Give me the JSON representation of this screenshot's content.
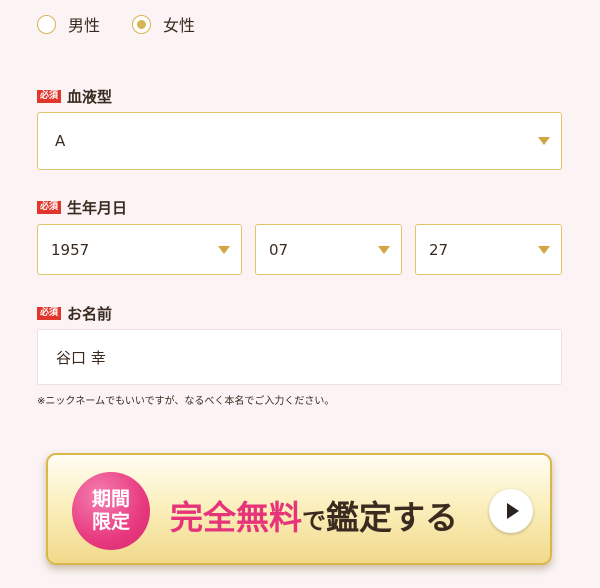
{
  "gender": {
    "options": [
      {
        "label": "男性",
        "selected": false
      },
      {
        "label": "女性",
        "selected": true
      }
    ]
  },
  "required_badge": "必須",
  "blood_type": {
    "label": "血液型",
    "value": "A"
  },
  "birthdate": {
    "label": "生年月日",
    "year": "1957",
    "month": "07",
    "day": "27"
  },
  "name": {
    "label": "お名前",
    "value": "谷口 幸"
  },
  "note": "※ニックネームでもいいですが、なるべく本名でご入力ください。",
  "cta": {
    "badge_line1": "期間",
    "badge_line2": "限定",
    "pink_text": "完全無料",
    "connector": "で",
    "dark_text": "鑑定する",
    "icon": "play-icon"
  },
  "colors": {
    "accent_gold": "#d7b455",
    "required_red": "#e0362c",
    "cta_pink": "#e6347a",
    "background": "#fbf3f4"
  }
}
